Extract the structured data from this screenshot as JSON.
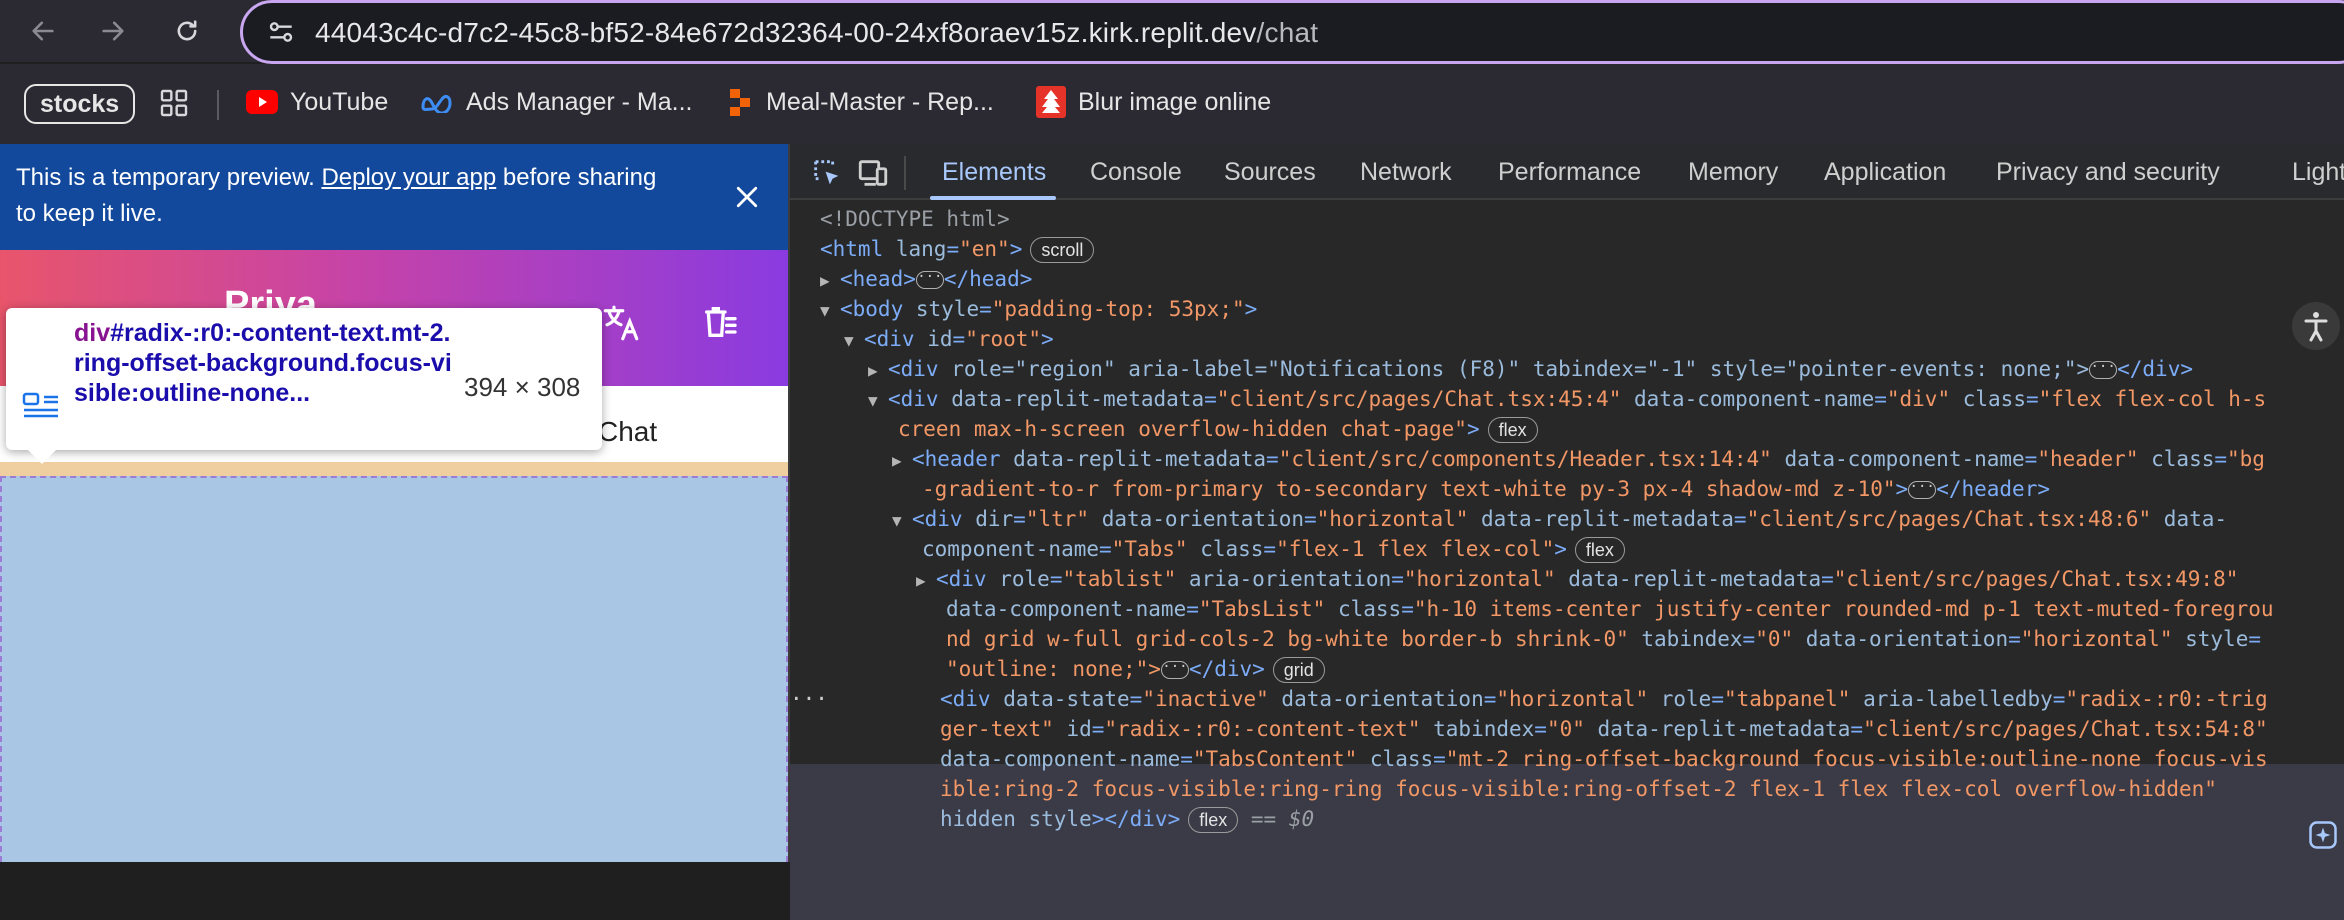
{
  "browser": {
    "url_host": "44043c4c-d7c2-45c8-bf52-84e672d32364-00-24xf8oraev15z.kirk.replit.dev",
    "url_path": "/chat",
    "bookmarks": [
      {
        "label": "stocks"
      },
      {
        "label": "YouTube"
      },
      {
        "label": "Ads Manager - Ma..."
      },
      {
        "label": "Meal-Master - Rep..."
      },
      {
        "label": "Blur image online"
      }
    ]
  },
  "preview": {
    "banner_text_1": "This is a temporary preview. ",
    "banner_link": "Deploy your app",
    "banner_text_2": " before sharing",
    "banner_text_3": "to keep it live.",
    "user_name": "Priya",
    "tab_label": "Chat",
    "tooltip_tag": "div",
    "tooltip_selector": "#radix-:r0:-content-text.mt-2.ring-offset-background.focus-visible:outline-none...",
    "tooltip_size": "394 × 308"
  },
  "devtools": {
    "tabs": [
      "Elements",
      "Console",
      "Sources",
      "Network",
      "Performance",
      "Memory",
      "Application",
      "Privacy and security",
      "Light"
    ],
    "active_tab": "Elements",
    "lines": {
      "doctype": "<!DOCTYPE html>",
      "html_open": "<html",
      "html_attr": "lang",
      "html_val": "\"en\"",
      "scroll_badge": "scroll",
      "head": "<head>",
      "head_close": "</head>",
      "body_open": "<body",
      "body_attr": "style",
      "body_val": "\"padding-top: 53px;\"",
      "root_div": "<div",
      "root_attr": "id",
      "root_val": "\"root\"",
      "region_div": "<div",
      "region_attrs": "role=\"region\" aria-label=\"Notifications (F8)\" tabindex=\"-1\" style=\"pointer-events: none;\">",
      "region_close": "</div>",
      "chat_div": "<div",
      "chat_attr1": "data-replit-metadata",
      "chat_val1": "\"client/src/pages/Chat.tsx:45:4\"",
      "chat_attr2": "data-component-name",
      "chat_val2": "\"div\"",
      "chat_attr3": "class",
      "chat_val3a": "\"flex flex-col h-s",
      "chat_val3b": "creen max-h-screen overflow-hidden chat-page\"",
      "flex_badge": "flex",
      "header_tag": "<header",
      "header_attr1": "data-replit-metadata",
      "header_val1": "\"client/src/components/Header.tsx:14:4\"",
      "header_attr2": "data-component-name",
      "header_val2": "\"header\"",
      "header_attr3": "class",
      "header_val3a": "\"bg",
      "header_val3b": "-gradient-to-r from-primary to-secondary text-white py-3 px-4 shadow-md z-10\"",
      "header_close": "</header>",
      "tabs_div": "<div",
      "tabs_attr1": "dir",
      "tabs_val1": "\"ltr\"",
      "tabs_attr2": "data-orientation",
      "tabs_val2": "\"horizontal\"",
      "tabs_attr3": "data-replit-metadata",
      "tabs_val3": "\"client/src/pages/Chat.tsx:48:6\"",
      "tabs_attr4a": "data-",
      "tabs_attr4b": "component-name",
      "tabs_val4": "\"Tabs\"",
      "tabs_attr5": "class",
      "tabs_val5": "\"flex-1 flex flex-col\"",
      "tablist_div": "<div",
      "tablist_attr1": "role",
      "tablist_val1": "\"tablist\"",
      "tablist_attr2": "aria-orientation",
      "tablist_val2": "\"horizontal\"",
      "tablist_attr3": "data-replit-metadata",
      "tablist_val3": "\"client/src/pages/Chat.tsx:49:8\"",
      "tablist_attr4": "data-component-name",
      "tablist_val4": "\"TabsList\"",
      "tablist_attr5": "class",
      "tablist_val5a": "\"h-10 items-center justify-center rounded-md p-1 text-muted-foregrou",
      "tablist_val5b": "nd grid w-full grid-cols-2 bg-white border-b shrink-0\"",
      "tablist_attr6": "tabindex",
      "tablist_val6": "\"0\"",
      "tablist_attr7": "data-orientation",
      "tablist_val7": "\"horizontal\"",
      "tablist_attr8": "style",
      "tablist_val8a": "=",
      "tablist_val8b": "\"outline: none;\">",
      "grid_badge": "grid",
      "sel_div": "<div",
      "sel_attr1": "data-state",
      "sel_val1": "\"inactive\"",
      "sel_attr2": "data-orientation",
      "sel_val2": "\"horizontal\"",
      "sel_attr3": "role",
      "sel_val3": "\"tabpanel\"",
      "sel_attr4": "aria-labelledby",
      "sel_val4a": "\"radix-:r0:-trig",
      "sel_val4b": "ger-text\"",
      "sel_attr5": "id",
      "sel_val5": "\"radix-:r0:-content-text\"",
      "sel_attr6": "tabindex",
      "sel_val6": "\"0\"",
      "sel_attr7": "data-replit-metadata",
      "sel_val7": "\"client/src/pages/Chat.tsx:54:8\"",
      "sel_attr8": "data-component-name",
      "sel_val8": "\"TabsContent\"",
      "sel_attr9": "class",
      "sel_val9a": "\"mt-2 ring-offset-background focus-visible:outline-none focus-vis",
      "sel_val9b": "ible:ring-2 focus-visible:ring-ring focus-visible:ring-offset-2 flex-1 flex flex-col overflow-hidden\"",
      "sel_attr10": "hidden style",
      "sel_close": "></div>",
      "dollar0": "== $0"
    }
  }
}
